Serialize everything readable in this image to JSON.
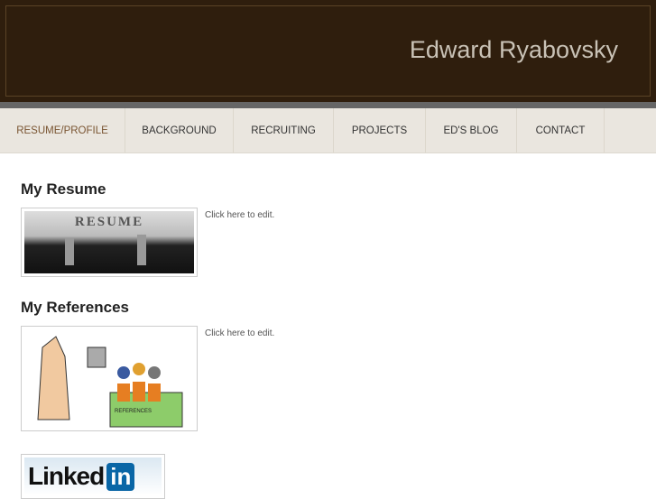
{
  "header": {
    "title": "Edward Ryabovsky"
  },
  "nav": [
    {
      "label": "RESUME/PROFILE",
      "active": true
    },
    {
      "label": "BACKGROUND"
    },
    {
      "label": "RECRUITING"
    },
    {
      "label": "PROJECTS"
    },
    {
      "label": "ED'S BLOG"
    },
    {
      "label": "CONTACT"
    }
  ],
  "sections": [
    {
      "title": "My Resume",
      "note": "Click here to edit.",
      "image_text": "RESUME"
    },
    {
      "title": "My References",
      "note": "Click here to edit.",
      "image_text": "REFERENCES"
    }
  ],
  "linkedin": {
    "text": "Linked",
    "badge": "in"
  }
}
